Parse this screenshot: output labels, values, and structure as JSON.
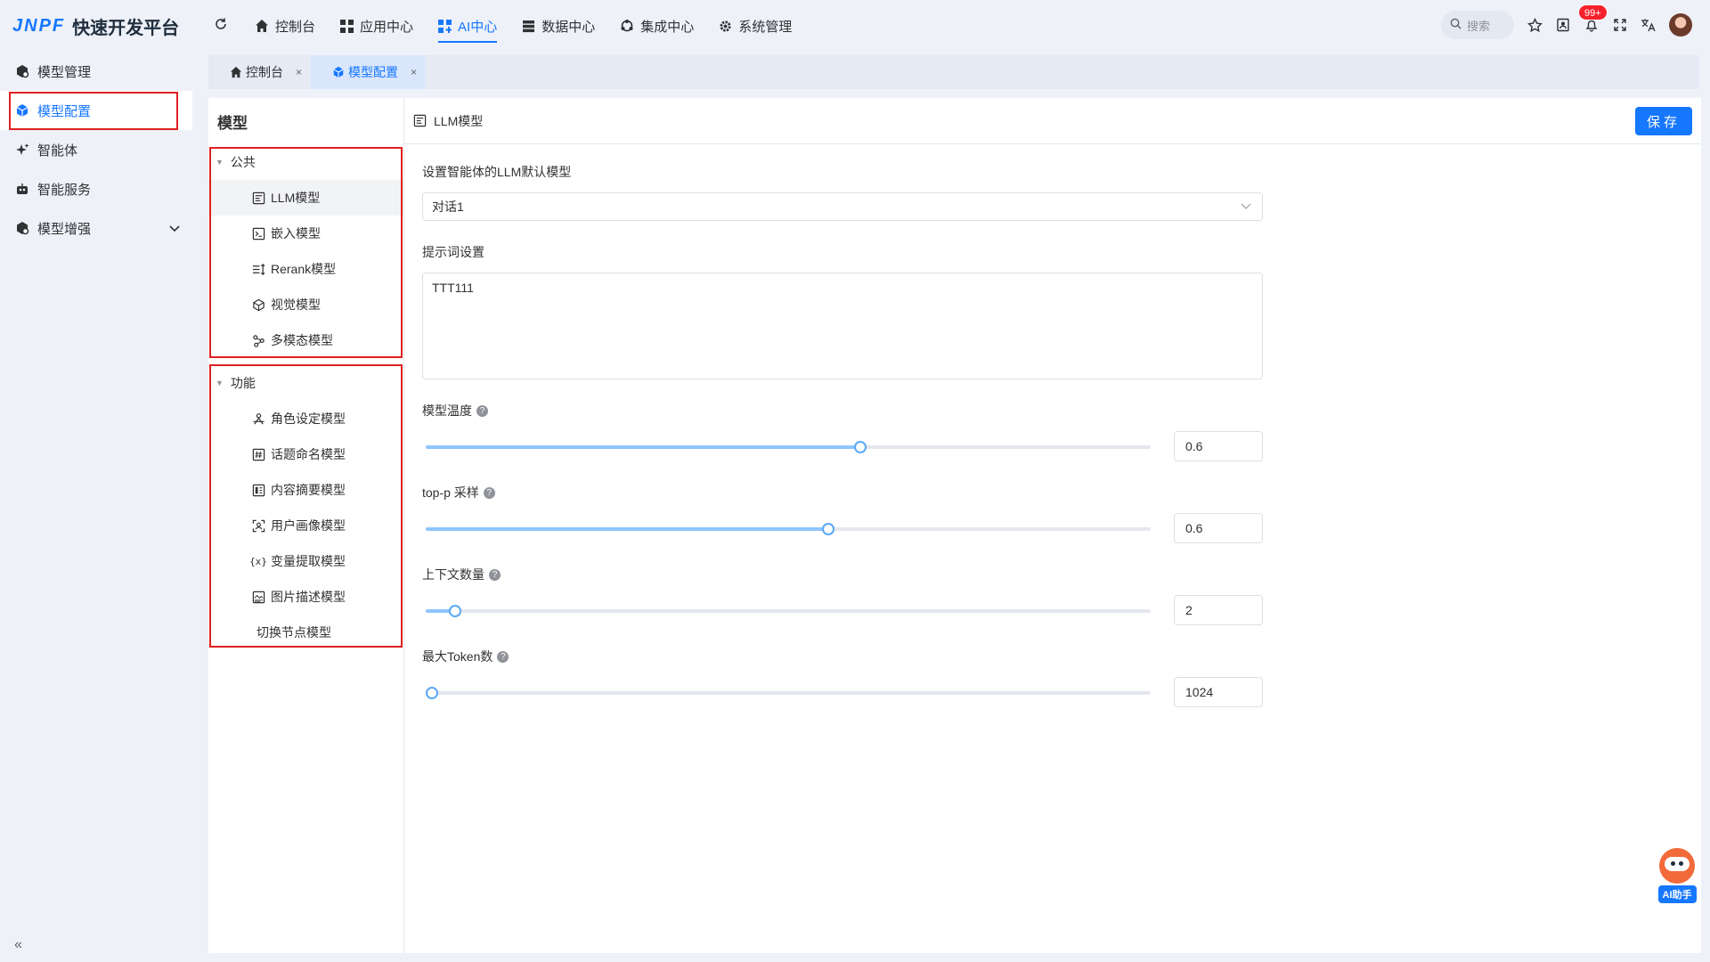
{
  "app": {
    "logo_mark": "JNPF",
    "title": "快速开发平台"
  },
  "sidebar": {
    "items": [
      {
        "label": "模型管理",
        "icon": "cube-gear-icon"
      },
      {
        "label": "模型配置",
        "icon": "cube-icon"
      },
      {
        "label": "智能体",
        "icon": "sparkle-icon"
      },
      {
        "label": "智能服务",
        "icon": "robot-icon"
      },
      {
        "label": "模型增强",
        "icon": "cube-gear-icon"
      }
    ],
    "active_index": 1,
    "collapse_glyph": "«"
  },
  "topnav": {
    "items": [
      {
        "label": "控制台",
        "icon": "home-icon"
      },
      {
        "label": "应用中心",
        "icon": "grid-icon"
      },
      {
        "label": "AI中心",
        "icon": "grid-plus-icon"
      },
      {
        "label": "数据中心",
        "icon": "database-icon"
      },
      {
        "label": "集成中心",
        "icon": "integration-icon"
      },
      {
        "label": "系统管理",
        "icon": "gear-icon"
      }
    ],
    "active_index": 2,
    "search_placeholder": "搜索",
    "notification_badge": "99+"
  },
  "tabs": [
    {
      "label": "控制台",
      "icon": "home-icon",
      "close": "×"
    },
    {
      "label": "模型配置",
      "icon": "cube-icon",
      "close": "×"
    }
  ],
  "left_panel": {
    "title": "模型",
    "groups": [
      {
        "label": "公共",
        "items": [
          "LLM模型",
          "嵌入模型",
          "Rerank模型",
          "视觉模型",
          "多模态模型"
        ]
      },
      {
        "label": "功能",
        "items": [
          "角色设定模型",
          "话题命名模型",
          "内容摘要模型",
          "用户画像模型",
          "变量提取模型",
          "图片描述模型",
          "切换节点模型"
        ]
      }
    ],
    "selected": "LLM模型"
  },
  "main": {
    "header_title": "LLM模型",
    "save_label": "保存",
    "default_model_label": "设置智能体的LLM默认模型",
    "default_model_value": "对话1",
    "prompt_label": "提示词设置",
    "prompt_value": "TTT111",
    "sliders": [
      {
        "label": "模型温度",
        "value": "0.6",
        "fraction": 0.6
      },
      {
        "label": "top-p 采样",
        "value": "0.6",
        "fraction": 0.555
      },
      {
        "label": "上下文数量",
        "value": "2",
        "fraction": 0.04
      },
      {
        "label": "最大Token数",
        "value": "1024",
        "fraction": 0.0
      }
    ]
  },
  "ai_helper": {
    "label": "AI助手"
  },
  "colors": {
    "accent": "#1677ff",
    "highlight_box": "#e02020",
    "slider_fill": "#8ec5ff"
  }
}
